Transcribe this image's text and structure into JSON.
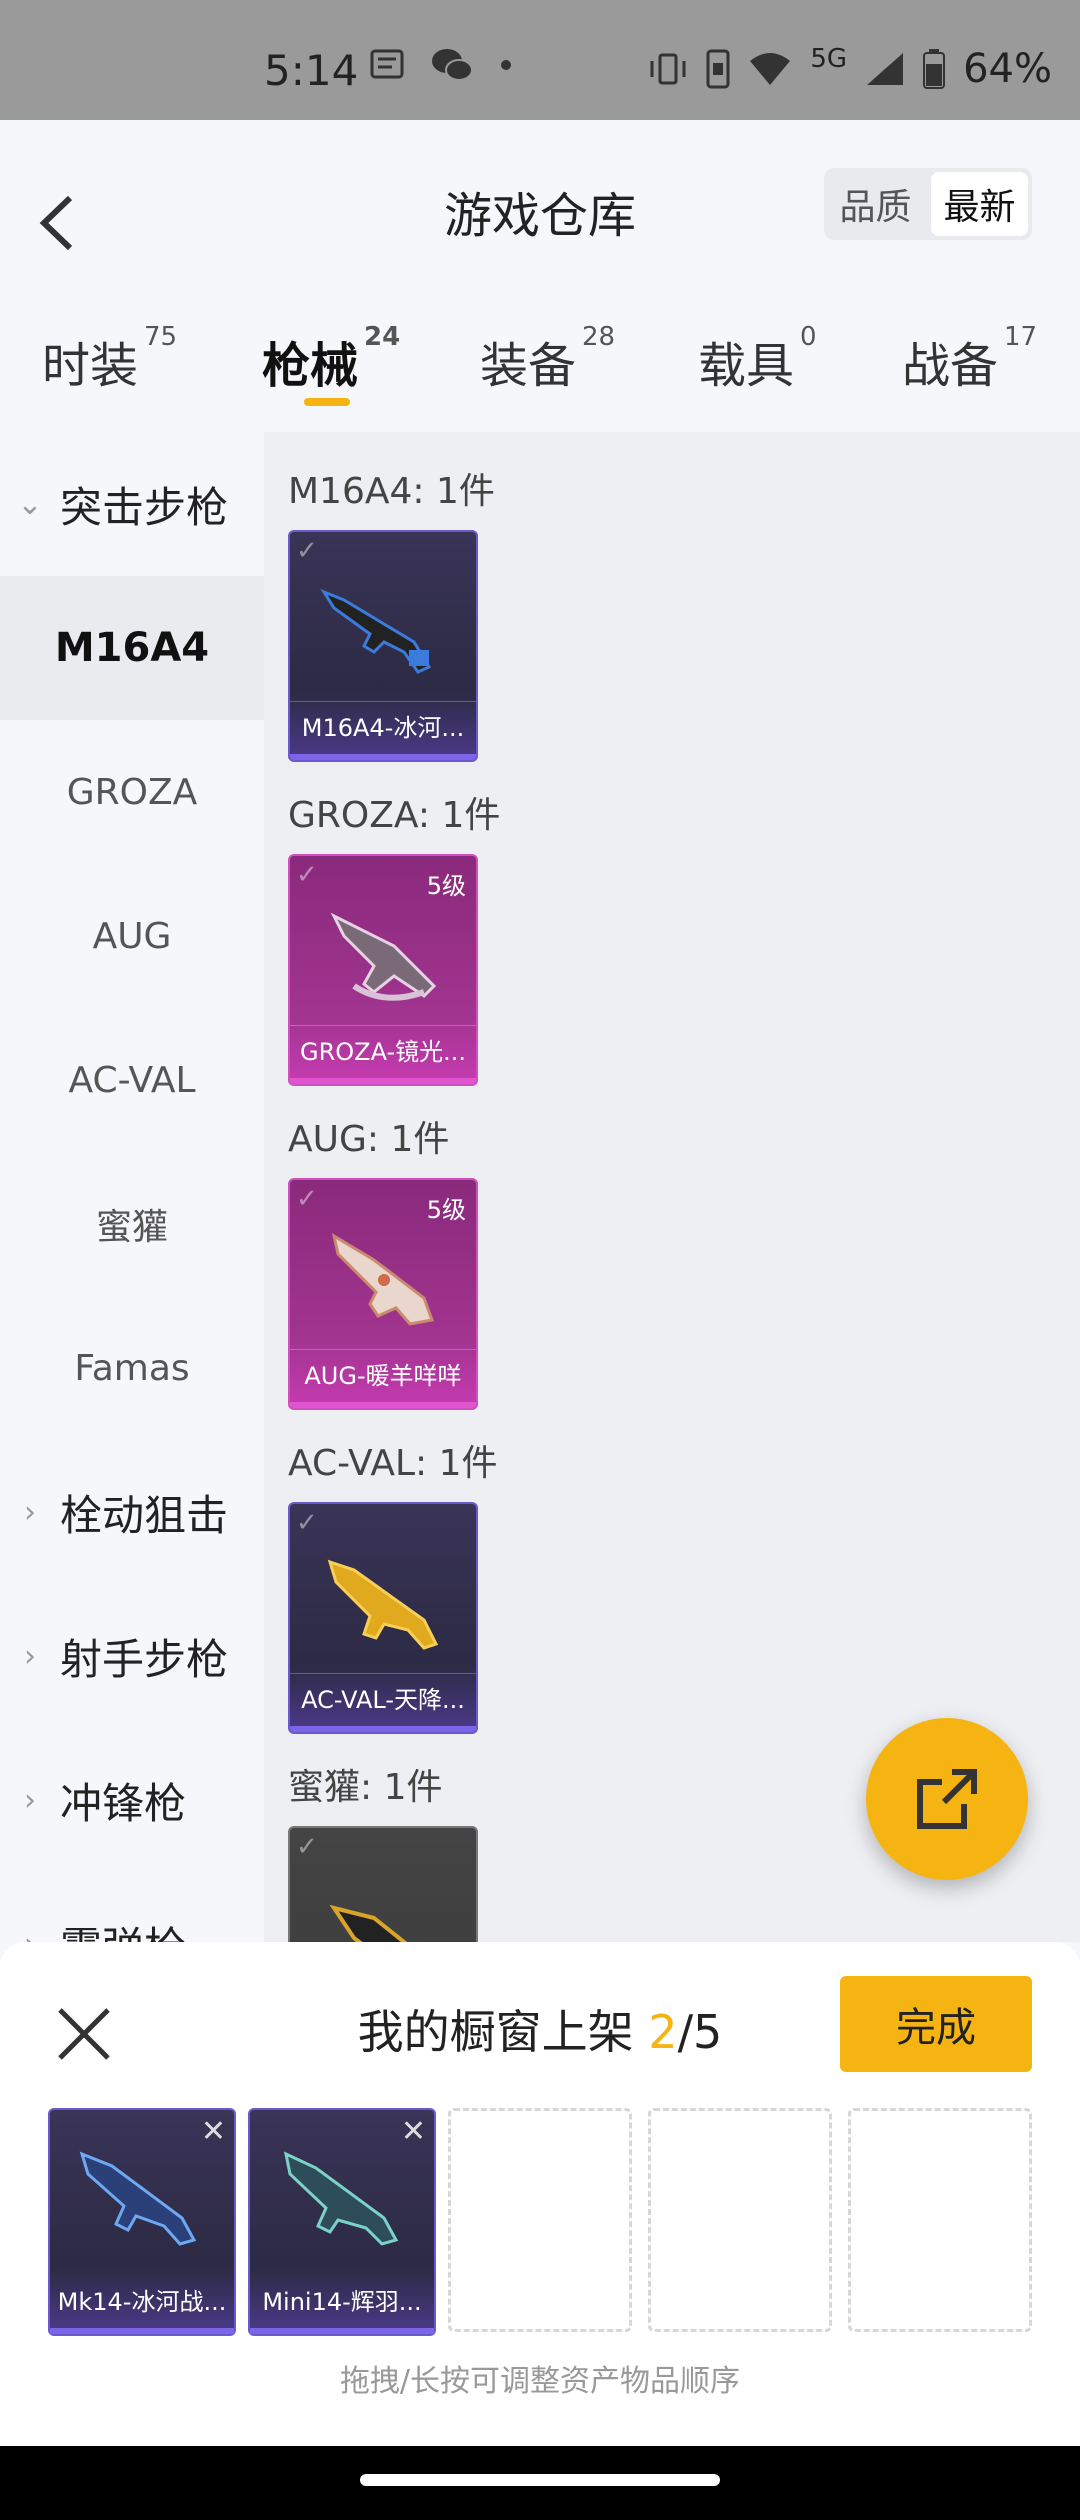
{
  "status_bar": {
    "time": "5:14",
    "network": "5G",
    "battery": "64%"
  },
  "header": {
    "title": "游戏仓库",
    "sort_quality": "品质",
    "sort_newest": "最新"
  },
  "tabs": [
    {
      "label": "时装",
      "count": "75"
    },
    {
      "label": "枪械",
      "count": "24"
    },
    {
      "label": "装备",
      "count": "28"
    },
    {
      "label": "载具",
      "count": "0"
    },
    {
      "label": "战备",
      "count": "17"
    }
  ],
  "sidebar": {
    "group_assault": "突击步枪",
    "items": [
      "M16A4",
      "GROZA",
      "AUG",
      "AC-VAL",
      "蜜獾",
      "Famas"
    ],
    "group_bolt": "栓动狙击",
    "group_marksman": "射手步枪",
    "group_smg": "冲锋枪",
    "group_shotgun": "霰弹枪"
  },
  "sections": [
    {
      "label": "M16A4: 1件",
      "item_name": "M16A4-冰河...",
      "level": ""
    },
    {
      "label": "GROZA: 1件",
      "item_name": "GROZA-镜光...",
      "level": "5级"
    },
    {
      "label": "AUG: 1件",
      "item_name": "AUG-暖羊咩咩",
      "level": "5级"
    },
    {
      "label": "AC-VAL: 1件",
      "item_name": "AC-VAL-天降...",
      "level": ""
    },
    {
      "label": "蜜獾: 1件",
      "item_name": "",
      "level": ""
    }
  ],
  "shelf": {
    "title": "我的橱窗上架",
    "count": "2",
    "total": "/5",
    "done_label": "完成",
    "slots": [
      {
        "name": "Mk14-冰河战..."
      },
      {
        "name": "Mini14-辉羽..."
      }
    ],
    "hint": "拖拽/长按可调整资产物品顺序"
  },
  "colors": {
    "accent": "#f6b412",
    "purple_rarity": "#7c65e8",
    "magenta_rarity": "#e055cf"
  }
}
